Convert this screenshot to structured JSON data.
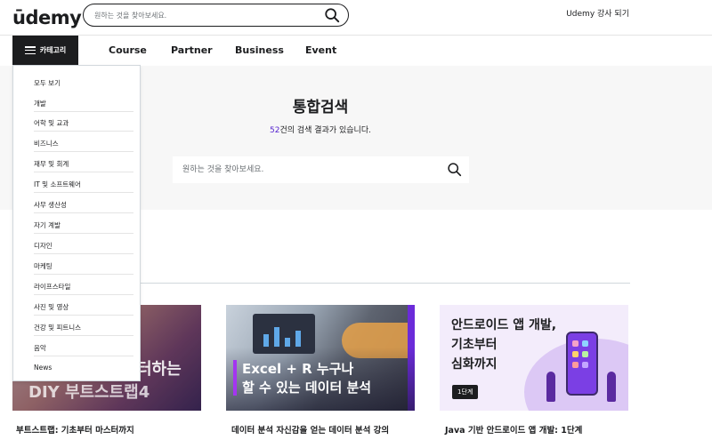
{
  "header": {
    "logo_text": "ūdemy",
    "search_placeholder": "원하는 것을 찾아보세요.",
    "instructor_link": "Udemy 강사 되기"
  },
  "nav": {
    "category_button": "카테고리",
    "links": [
      "Course",
      "Partner",
      "Business",
      "Event"
    ]
  },
  "hero": {
    "title": "통합검색",
    "result_count": "52",
    "result_text": "건의 검색 결과가 있습니다.",
    "search_placeholder": "원하는 것을 찾아보세요."
  },
  "category_menu": {
    "items": [
      "모두 보기",
      "개발",
      "어학 및 교과",
      "비즈니스",
      "재무 및 회계",
      "IT 및 소프트웨어",
      "사무 생산성",
      "자기 계발",
      "디자인",
      "마케팅",
      "라이프스타일",
      "사진 및 영상",
      "건강 및 피트니스",
      "음악",
      "News"
    ]
  },
  "courses": [
    {
      "title": "부트스트랩: 기초부터 마스터까지",
      "thumb_line1": "터하는",
      "thumb_line2": "DIY 부트스트랩4"
    },
    {
      "title": "데이터 분석 자신감을 얻는 데이터 분석 강의",
      "thumb_line1": "Excel + R 누구나",
      "thumb_line2": "할 수 있는 데이터 분석"
    },
    {
      "title": "Java 기반 안드로이드 앱 개발: 1단계",
      "thumb_line1": "안드로이드 앱 개발,",
      "thumb_line2": "기초부터",
      "thumb_line3": "심화까지",
      "thumb_badge": "1단계"
    }
  ],
  "colors": {
    "brand": "#a435f0",
    "dark": "#1c1d1f",
    "link_number": "#5624d0"
  }
}
